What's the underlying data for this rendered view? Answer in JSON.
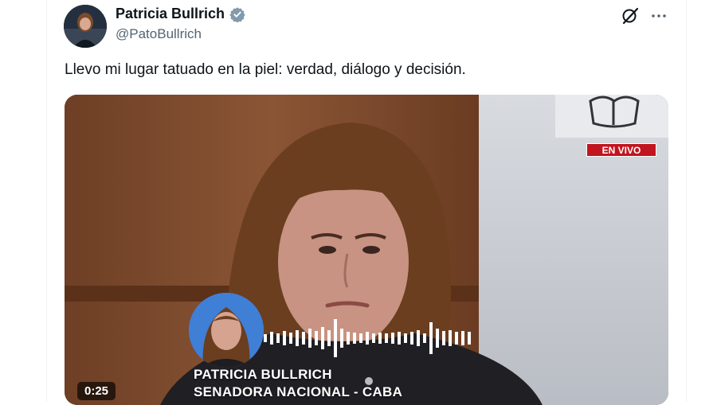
{
  "tweet": {
    "author_name": "Patricia Bullrich",
    "author_handle": "@PatoBullrich",
    "text": "Llevo mi lugar tatuado en la piel: verdad, diálogo y decisión.",
    "verified_icon": "verified-badge-icon",
    "grok_icon": "grok-icon",
    "more_icon": "more-options-icon"
  },
  "media": {
    "live_badge": "EN VIVO",
    "caption_name": "PATRICIA BULLRICH",
    "caption_role": "SENADORA NACIONAL - CABA",
    "time": "0:25",
    "live_color": "#c1151f"
  },
  "colors": {
    "name": "#0f1419",
    "handle": "#536471",
    "verified": "#829aab"
  }
}
